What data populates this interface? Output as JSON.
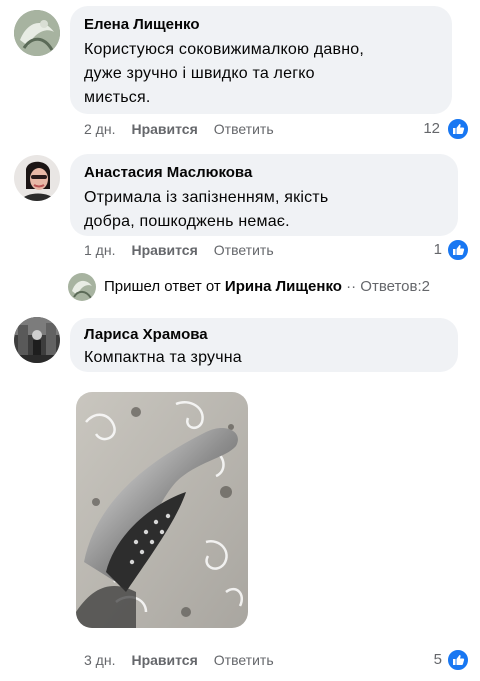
{
  "comments": [
    {
      "author": "Елена Лищенко",
      "text": "Користуюся соковижималкою давно,\nдуже зручно і швидко та легко\nмиється.",
      "time": "2 дн.",
      "like_label": "Нравится",
      "reply_label": "Ответить",
      "reactions": "12"
    },
    {
      "author": "Анастасия Маслюкова",
      "text": "Отримала із запізненням, якість\nдобра, пошкоджень немає.",
      "time": "1 дн.",
      "like_label": "Нравится",
      "reply_label": "Ответить",
      "reactions": "1"
    },
    {
      "author": "Лариса Храмова",
      "text": "Компактна та зручна",
      "time": "3 дн.",
      "like_label": "Нравится",
      "reply_label": "Ответить",
      "reactions": "5"
    }
  ],
  "reply_thread": {
    "prefix": "Пришел ответ от",
    "name": "Ирина Лищенко",
    "separator": "··",
    "replies_label": "Ответов:2"
  },
  "colors": {
    "bubble": "#f0f2f5",
    "meta": "#65676b",
    "like_blue": "#1877f2"
  },
  "icons": {
    "reaction": "thumbs-up-icon"
  }
}
